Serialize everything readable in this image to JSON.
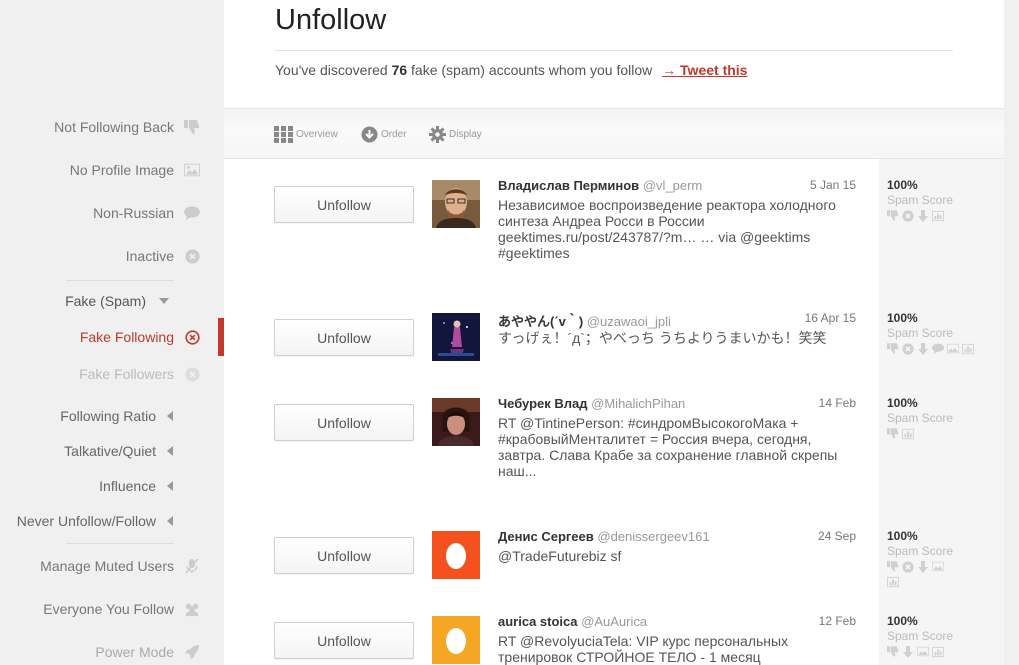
{
  "sidebar": {
    "items": [
      {
        "label": "Not Following Back",
        "icon": "thumbs-down-icon"
      },
      {
        "label": "No Profile Image",
        "icon": "image-icon"
      },
      {
        "label": "Non-Russian",
        "icon": "speech-bubble-icon"
      },
      {
        "label": "Inactive",
        "icon": "x-circle-icon"
      },
      {
        "label": "Fake (Spam)",
        "icon": "caret-down-icon"
      },
      {
        "label": "Fake Following",
        "icon": "x-circle-icon"
      },
      {
        "label": "Fake Followers",
        "icon": "x-circle-icon"
      },
      {
        "label": "Following Ratio",
        "icon": "caret-left-icon"
      },
      {
        "label": "Talkative/Quiet",
        "icon": "caret-left-icon"
      },
      {
        "label": "Influence",
        "icon": "caret-left-icon"
      },
      {
        "label": "Never Unfollow/Follow",
        "icon": "caret-left-icon"
      },
      {
        "label": "Manage Muted Users",
        "icon": "mute-icon"
      },
      {
        "label": "Everyone You Follow",
        "icon": "users-icon"
      },
      {
        "label": "Power Mode",
        "icon": "rocket-icon"
      }
    ]
  },
  "main": {
    "title": "Unfollow",
    "summary_prefix": "You've discovered",
    "summary_count": "76",
    "summary_suffix": "fake (spam) accounts whom you follow",
    "tweet_link": "→ Tweet this",
    "toolbar": {
      "overview": "Overview",
      "order": "Order",
      "display": "Display"
    }
  },
  "users": [
    {
      "button": "Unfollow",
      "name": "Владислав Перминов",
      "handle": "@vl_perm",
      "date": "5 Jan 15",
      "text": "Независимое воспроизведение реактора холодного синтеза Андреа Росси в России geektimes.ru/post/243787/?m… … via @geektims #geektimes",
      "score": "100%",
      "score_label": "Spam Score"
    },
    {
      "button": "Unfollow",
      "name": "あややん(´v｀)",
      "handle": "@uzawaoi_jpli",
      "date": "16 Apr 15",
      "text": "すっげぇ！´д`；やべっち うちよりうまいかも！笑笑",
      "score": "100%",
      "score_label": "Spam Score"
    },
    {
      "button": "Unfollow",
      "name": "Чебурек Влад",
      "handle": "@MihalichPihan",
      "date": "14 Feb",
      "text": "RT @TintinePerson: #синдромВысокогоМака + #крабовыйМенталитет = Россия вчера, сегодня, завтра. Слава Крабе за сохранение главной скрепы наш...",
      "score": "100%",
      "score_label": "Spam Score"
    },
    {
      "button": "Unfollow",
      "name": "Денис Сергеев",
      "handle": "@denissergeev161",
      "date": "24 Sep",
      "text": "@TradeFuturebiz sf",
      "score": "100%",
      "score_label": "Spam Score"
    },
    {
      "button": "Unfollow",
      "name": "aurica stoica",
      "handle": "@AuAurica",
      "date": "12 Feb",
      "text": "RT @RevolyuciaTela: VIP курс персональных тренировок СТРОЙНОЕ ТЕЛО - 1 месяц",
      "score": "100%",
      "score_label": "Spam Score"
    }
  ],
  "colors": {
    "accent": "#c0392b",
    "egg_orange": "#f4511e",
    "egg_yellow": "#f5a623"
  }
}
